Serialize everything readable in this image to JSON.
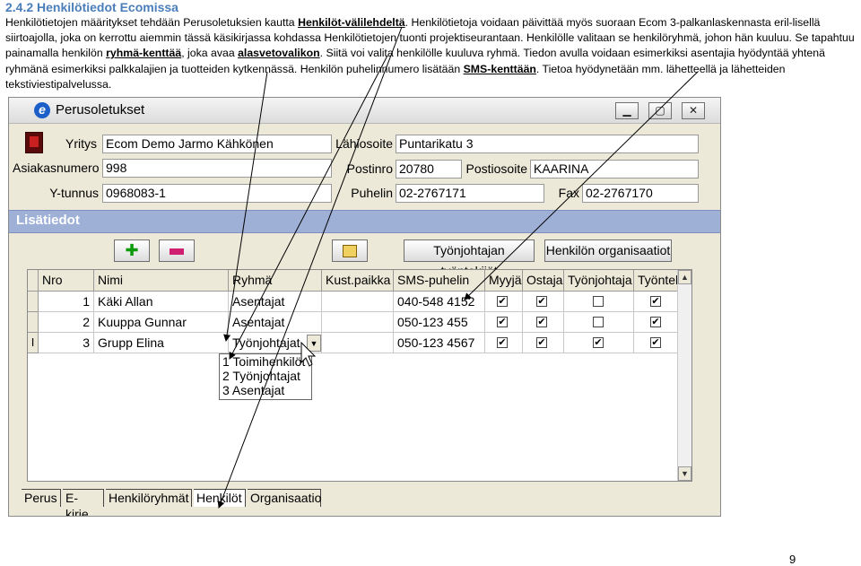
{
  "doc": {
    "heading": "2.4.2 Henkilötiedot Ecomissa",
    "p1_a": "Henkilötietojen määritykset tehdään Perusoletuksien kautta ",
    "p1_link": "Henkilöt-välilehdeltä",
    "p1_b": ". Henkilötietoja voidaan päivittää myös suoraan Ecom 3-palkanlaskennasta eril-lisellä siirtoajolla, joka on kerrottu aiemmin tässä käsikirjassa kohdassa Henkilötietojen tuonti projektiseurantaan. Henkilölle valitaan se henkilöryhmä, johon hän kuuluu. Se tapahtuu painamalla henkilön ",
    "p1_link2": "ryhmä-kenttää",
    "p1_c": ", joka avaa ",
    "p1_link3": "alasvetovalikon",
    "p1_d": ". Siitä voi valita henkilölle kuuluva ryhmä. Tiedon avulla voidaan esimerkiksi asentajia hyödyntää yhtenä ryhmänä esimerkiksi palkkalajien ja tuotteiden kytkennässä. Henkilön puhelinnumero lisätään ",
    "p1_link4": "SMS-kenttään",
    "p1_e": ". Tietoa hyödynetään mm. lähetteellä ja lähetteiden tekstiviestipalvelussa.",
    "page_number": "9"
  },
  "window": {
    "title": "Perusoletukset",
    "minimize": "▁",
    "maximize": "▢",
    "close": "✕"
  },
  "form": {
    "yritys_label": "Yritys",
    "yritys_value": "Ecom Demo Jarmo Kähkönen",
    "asiakasnumero_label": "Asiakasnumero",
    "asiakasnumero_value": "998",
    "ytunnus_label": "Y-tunnus",
    "ytunnus_value": "0968083-1",
    "lahiosoite_label": "Lähiosoite",
    "lahiosoite_value": "Puntarikatu 3",
    "postinro_label": "Postinro",
    "postinro_value": "20780",
    "postiosoite_label": "Postiosoite",
    "postiosoite_value": "KAARINA",
    "puhelin_label": "Puhelin",
    "puhelin_value": "02-2767171",
    "fax_label": "Fax",
    "fax_value": "02-2767170"
  },
  "section": {
    "title": "Lisätiedot"
  },
  "toolbar": {
    "add_icon": "plus-icon",
    "remove_icon": "minus-icon",
    "copy_icon": "copy-icon",
    "btn_tyontekijat": "Työnjohtajan työntekijät",
    "btn_organisaatiot": "Henkilön organisaatiot"
  },
  "grid": {
    "columns": [
      "Nro",
      "Nimi",
      "Ryhmä",
      "Kust.paikka",
      "SMS-puhelin",
      "Myyjä",
      "Ostaja",
      "Työnjohtaja",
      "Työntekijä"
    ],
    "rows": [
      {
        "nro": "1",
        "nimi": "Käki Allan",
        "ryhma": "Asentajat",
        "kust": "",
        "sms": "040-548 4152",
        "myyja": "✔",
        "ostaja": "✔",
        "tyonjohtaja": "",
        "tyontekija": "✔"
      },
      {
        "nro": "2",
        "nimi": "Kuuppa Gunnar",
        "ryhma": "Asentajat",
        "kust": "",
        "sms": "050-123 455",
        "myyja": "✔",
        "ostaja": "✔",
        "tyonjohtaja": "",
        "tyontekija": "✔"
      },
      {
        "nro": "3",
        "nimi": "Grupp Elina",
        "ryhma": "Työnjohtajat",
        "kust": "",
        "sms": "050-123 4567",
        "myyja": "✔",
        "ostaja": "✔",
        "tyonjohtaja": "✔",
        "tyontekija": "✔"
      }
    ],
    "row_indicator": "I",
    "dropdown_options": [
      "1 Toimihenkilöt",
      "2 Työnjohtajat",
      "3 Asentajat"
    ]
  },
  "tabs": [
    "Perus",
    "E-kirje",
    "Henkilöryhmät",
    "Henkilöt",
    "Organisaatio"
  ],
  "active_tab": "Henkilöt"
}
